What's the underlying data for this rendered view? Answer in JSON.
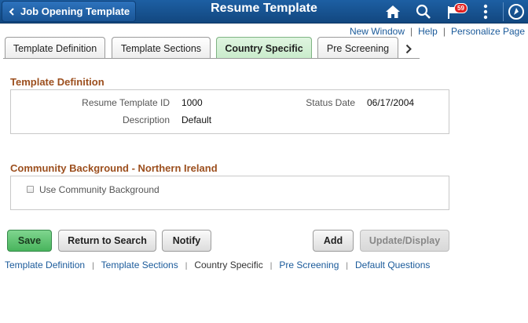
{
  "header": {
    "back_label": "Job Opening Template",
    "title": "Resume Template",
    "notification_count": "59",
    "icons": [
      "home-icon",
      "search-icon",
      "notification-flag-icon",
      "actions-menu-icon",
      "navbar-icon"
    ]
  },
  "top_links": {
    "new_window": "New Window",
    "help": "Help",
    "personalize": "Personalize Page",
    "separator": "|"
  },
  "tabs": [
    {
      "label": "Template Definition",
      "active": false
    },
    {
      "label": "Template Sections",
      "active": false
    },
    {
      "label": "Country Specific",
      "active": true
    },
    {
      "label": "Pre Screening",
      "active": false
    }
  ],
  "template_definition": {
    "title": "Template Definition",
    "resume_template_id_label": "Resume Template ID",
    "resume_template_id": "1000",
    "status_date_label": "Status Date",
    "status_date": "06/17/2004",
    "description_label": "Description",
    "description": "Default"
  },
  "community": {
    "title": "Community Background - Northern Ireland",
    "checkbox_label": "Use Community Background",
    "checked": false
  },
  "buttons": {
    "save": "Save",
    "return_to_search": "Return to Search",
    "notify": "Notify",
    "add": "Add",
    "update_display": "Update/Display"
  },
  "bottom_links": {
    "items": [
      "Template Definition",
      "Template Sections",
      "Country Specific",
      "Pre Screening",
      "Default Questions"
    ],
    "separator": "|"
  },
  "colors": {
    "header_blue": "#1d5fa3",
    "section_title": "#9c4f1e",
    "link": "#1a5a9a",
    "active_tab": "#c9ebcb",
    "save_button": "#48b45c"
  }
}
